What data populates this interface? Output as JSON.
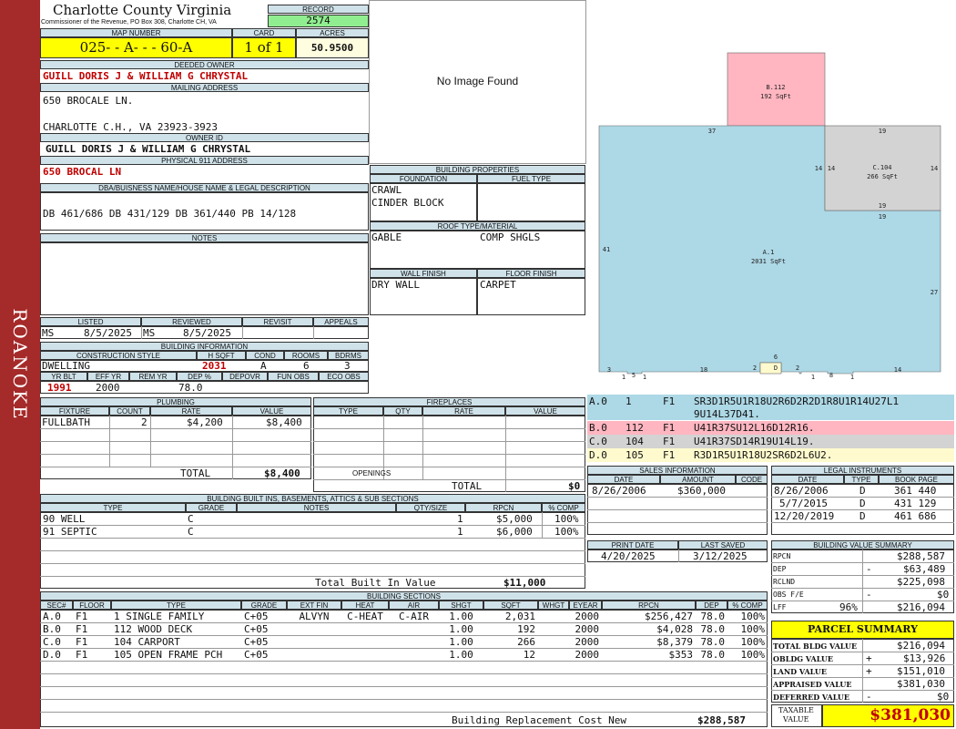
{
  "sidebar_label": "ROANOKE",
  "header": {
    "county": "Charlotte County Virginia",
    "office": "Commissioner of the Revenue, PO Box 308, Charlotte CH, VA",
    "record_label": "RECORD",
    "record_value": "2574",
    "map_label": "MAP NUMBER",
    "map_value": "025- - A- - - 60-A",
    "card_label": "CARD",
    "card_value": "1 of 1",
    "acres_label": "ACRES",
    "acres_value": "50.9500"
  },
  "owner": {
    "deeded_label": "DEEDED OWNER",
    "deeded_value": "GUILL DORIS J & WILLIAM G CHRYSTAL",
    "mailing_label": "MAILING ADDRESS",
    "mailing_line1": "650 BROCALE LN.",
    "mailing_line2": "CHARLOTTE C.H., VA 23923-3923",
    "owner_id_label": "OWNER ID",
    "owner_id_value": "GUILL DORIS J & WILLIAM G CHRYSTAL",
    "physical_label": "PHYSICAL 911 ADDRESS",
    "physical_value": "650 BROCAL LN"
  },
  "legal": {
    "label": "DBA/BUISNESS NAME/HOUSE NAME & LEGAL DESCRIPTION",
    "value": "DB 461/686 DB 431/129 DB 361/440 PB 14/128"
  },
  "notes_label": "NOTES",
  "image_placeholder": "No Image Found",
  "listing": {
    "headers": [
      "LISTED",
      "REVIEWED",
      "REVISIT",
      "APPEALS"
    ],
    "listed_by": "MS",
    "listed_date": "8/5/2025",
    "reviewed_by": "MS",
    "reviewed_date": "8/5/2025"
  },
  "building_info": {
    "label": "BUILDING INFORMATION",
    "h1": [
      "CONSTRUCTION STYLE",
      "H SQFT",
      "COND",
      "ROOMS",
      "BDRMS"
    ],
    "v1": [
      "DWELLING",
      "2031",
      "A",
      "6",
      "3"
    ],
    "h2": [
      "YR BLT",
      "EFF YR",
      "REM YR",
      "DEP %",
      "DEPOVR",
      "FUN OBS",
      "ECO OBS"
    ],
    "v2": [
      "1991",
      "2000",
      "",
      "78.0",
      "",
      "",
      ""
    ]
  },
  "building_props": {
    "label": "BUILDING PROPERTIES",
    "foundation_label": "FOUNDATION",
    "fuel_label": "FUEL TYPE",
    "foundation_lines": [
      "CRAWL",
      "CINDER BLOCK"
    ],
    "roof_label": "ROOF TYPE/MATERIAL",
    "roof_type": "GABLE",
    "roof_material": "COMP SHGLS",
    "wall_label": "WALL FINISH",
    "floor_label": "FLOOR FINISH",
    "wall_value": "DRY WALL",
    "floor_value": "CARPET"
  },
  "sketch": {
    "areas": [
      {
        "code": "A.1",
        "sqft": "2031 SqFt",
        "color": "#add8e6"
      },
      {
        "code": "B.112",
        "sqft": "192 SqFt",
        "color": "#ffb6c1"
      },
      {
        "code": "C.104",
        "sqft": "266 SqFt",
        "color": "#d3d3d3"
      },
      {
        "code": "D",
        "sqft": "",
        "color": "#fffacd"
      }
    ],
    "dims": [
      "37",
      "19",
      "14",
      "14",
      "14",
      "19",
      "19",
      "41",
      "27",
      "6",
      "3",
      "1",
      "5",
      "1",
      "18",
      "2",
      "2",
      "1",
      "8",
      "1",
      "14"
    ]
  },
  "sketch_legend": [
    {
      "code": "A.0",
      "num": "1",
      "floor": "F1",
      "vectors": "SR3D1R5U1R18U2R6D2R2D1R8U1R14U27L1",
      "vectors2": "9U14L37D41.",
      "color": "#add8e6"
    },
    {
      "code": "B.0",
      "num": "112",
      "floor": "F1",
      "vectors": "U41R37SU12L16D12R16.",
      "color": "#ffb6c1"
    },
    {
      "code": "C.0",
      "num": "104",
      "floor": "F1",
      "vectors": "U41R37SD14R19U14L19.",
      "color": "#d3d3d3"
    },
    {
      "code": "D.0",
      "num": "105",
      "floor": "F1",
      "vectors": "R3D1R5U1R18U2SR6D2L6U2.",
      "color": "#fffacd"
    }
  ],
  "plumbing": {
    "label": "PLUMBING",
    "headers": [
      "FIXTURE",
      "COUNT",
      "RATE",
      "VALUE"
    ],
    "rows": [
      {
        "fixture": "FULLBATH",
        "count": "2",
        "rate": "$4,200",
        "value": "$8,400"
      }
    ],
    "total_label": "TOTAL",
    "total_value": "$8,400"
  },
  "fireplaces": {
    "label": "FIREPLACES",
    "headers": [
      "TYPE",
      "QTY",
      "RATE",
      "VALUE"
    ],
    "openings_label": "OPENINGS",
    "total_label": "TOTAL",
    "total_value": "$0"
  },
  "sales": {
    "label": "SALES INFORMATION",
    "headers": [
      "DATE",
      "AMOUNT",
      "CODE"
    ],
    "rows": [
      {
        "date": "8/26/2006",
        "amount": "$360,000",
        "code": ""
      }
    ]
  },
  "legal_instruments": {
    "label": "LEGAL INSTRUMENTS",
    "headers": [
      "DATE",
      "TYPE",
      "BOOK PAGE"
    ],
    "rows": [
      {
        "date": "8/26/2006",
        "type": "D",
        "book": "361 440"
      },
      {
        "date": "5/7/2015",
        "type": "D",
        "book": "431 129"
      },
      {
        "date": "12/20/2019",
        "type": "D",
        "book": "461 686"
      }
    ]
  },
  "dates": {
    "print_label": "PRINT DATE",
    "saved_label": "LAST SAVED",
    "print_value": "4/20/2025",
    "saved_value": "3/12/2025"
  },
  "builtins": {
    "label": "BUILDING BUILT INS, BASEMENTS, ATTICS & SUB SECTIONS",
    "headers": [
      "TYPE",
      "GRADE",
      "NOTES",
      "QTY/SIZE",
      "RPCN",
      "% COMP"
    ],
    "rows": [
      {
        "type": "90 WELL",
        "grade": "C",
        "notes": "",
        "qty": "1",
        "rpcn": "$5,000",
        "comp": "100%"
      },
      {
        "type": "91 SEPTIC",
        "grade": "C",
        "notes": "",
        "qty": "1",
        "rpcn": "$6,000",
        "comp": "100%"
      }
    ],
    "total_label": "Total Built In Value",
    "total_value": "$11,000"
  },
  "value_summary": {
    "label": "BUILDING VALUE SUMMARY",
    "rows": [
      {
        "label": "RPCN",
        "sign": "",
        "value": "$288,587"
      },
      {
        "label": "DEP",
        "sign": "-",
        "value": "$63,489"
      },
      {
        "label": "RCLND",
        "sign": "",
        "value": "$225,098"
      },
      {
        "label": "OBS F/E",
        "sign": "-",
        "value": "$0"
      },
      {
        "label": "LFF",
        "sign": "96%",
        "value": "$216,094"
      }
    ]
  },
  "parcel_summary": {
    "title": "PARCEL SUMMARY",
    "rows": [
      {
        "label": "TOTAL BLDG VALUE",
        "sign": "",
        "value": "$216,094"
      },
      {
        "label": "OBLDG VALUE",
        "sign": "+",
        "value": "$13,926"
      },
      {
        "label": "LAND VALUE",
        "sign": "+",
        "value": "$151,010"
      },
      {
        "label": "APPRAISED VALUE",
        "sign": "",
        "value": "$381,030"
      },
      {
        "label": "DEFERRED VALUE",
        "sign": "-",
        "value": "$0"
      }
    ],
    "taxable_label1": "TAXABLE",
    "taxable_label2": "VALUE",
    "taxable_value": "$381,030"
  },
  "sections": {
    "label": "BUILDING SECTIONS",
    "headers": [
      "SEC#",
      "FLOOR",
      "TYPE",
      "GRADE",
      "EXT FIN",
      "HEAT",
      "AIR",
      "SHGT",
      "SQFT",
      "WHGT",
      "EYEAR",
      "RPCN",
      "DEP",
      "% COMP"
    ],
    "rows": [
      {
        "sec": "A.0",
        "floor": "F1",
        "type": "1 SINGLE FAMILY",
        "grade": "C+05",
        "ext": "ALVYN",
        "heat": "C-HEAT",
        "air": "C-AIR",
        "shgt": "1.00",
        "sqft": "2,031",
        "whgt": "",
        "eyear": "2000",
        "rpcn": "$256,427",
        "dep": "78.0",
        "comp": "100%"
      },
      {
        "sec": "B.0",
        "floor": "F1",
        "type": "112 WOOD DECK",
        "grade": "C+05",
        "ext": "",
        "heat": "",
        "air": "",
        "shgt": "1.00",
        "sqft": "192",
        "whgt": "",
        "eyear": "2000",
        "rpcn": "$4,028",
        "dep": "78.0",
        "comp": "100%"
      },
      {
        "sec": "C.0",
        "floor": "F1",
        "type": "104 CARPORT",
        "grade": "C+05",
        "ext": "",
        "heat": "",
        "air": "",
        "shgt": "1.00",
        "sqft": "266",
        "whgt": "",
        "eyear": "2000",
        "rpcn": "$8,379",
        "dep": "78.0",
        "comp": "100%"
      },
      {
        "sec": "D.0",
        "floor": "F1",
        "type": "105 OPEN FRAME PCH",
        "grade": "C+05",
        "ext": "",
        "heat": "",
        "air": "",
        "shgt": "1.00",
        "sqft": "12",
        "whgt": "",
        "eyear": "2000",
        "rpcn": "$353",
        "dep": "78.0",
        "comp": "100%"
      }
    ],
    "rcn_label": "Building Replacement Cost New",
    "rcn_value": "$288,587"
  }
}
